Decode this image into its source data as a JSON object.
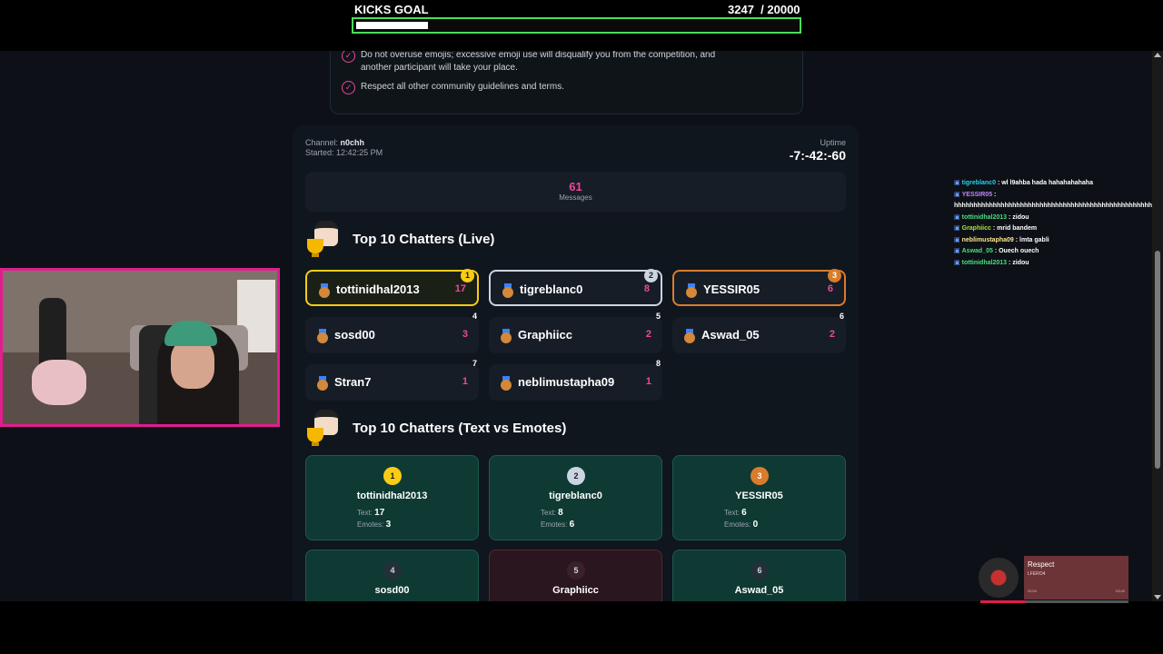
{
  "goal": {
    "title": "KICKS GOAL",
    "current": "3247",
    "target": "/ 20000",
    "progress": 0.162,
    "fill_color": "#ffffff",
    "border_color": "#4ade5a"
  },
  "rules": [
    "Do not overuse emojis; excessive emoji use will disqualify you from the competition, and another participant will take your place.",
    "Respect all other community guidelines and terms."
  ],
  "stream": {
    "channel_label": "Channel:",
    "channel": "n0chh",
    "started_label": "Started:",
    "started": "12:42:25 PM",
    "uptime_label": "Uptime",
    "uptime": "-7:-42:-60",
    "messages_count": "61",
    "messages_label": "Messages"
  },
  "live": {
    "title": "Top 10 Chatters (Live)",
    "chatters": [
      {
        "rank": "1",
        "name": "tottinidhal2013",
        "count": "17",
        "tier": "gold"
      },
      {
        "rank": "2",
        "name": "tigreblanc0",
        "count": "8",
        "tier": "silver"
      },
      {
        "rank": "3",
        "name": "YESSIR05",
        "count": "6",
        "tier": "bronze"
      },
      {
        "rank": "4",
        "name": "sosd00",
        "count": "3",
        "tier": ""
      },
      {
        "rank": "5",
        "name": "Graphiicc",
        "count": "2",
        "tier": ""
      },
      {
        "rank": "6",
        "name": "Aswad_05",
        "count": "2",
        "tier": ""
      },
      {
        "rank": "7",
        "name": "Stran7",
        "count": "1",
        "tier": ""
      },
      {
        "rank": "8",
        "name": "neblimustapha09",
        "count": "1",
        "tier": ""
      }
    ]
  },
  "split": {
    "title": "Top 10 Chatters (Text vs Emotes)",
    "text_label": "Text:",
    "emotes_label": "Emotes:",
    "cards": [
      {
        "rank": "1",
        "name": "tottinidhal2013",
        "text": "17",
        "emotes": "3",
        "tier": "gold"
      },
      {
        "rank": "2",
        "name": "tigreblanc0",
        "text": "8",
        "emotes": "6",
        "tier": "silver"
      },
      {
        "rank": "3",
        "name": "YESSIR05",
        "text": "6",
        "emotes": "0",
        "tier": "bronze"
      },
      {
        "rank": "4",
        "name": "sosd00",
        "tier": ""
      },
      {
        "rank": "5",
        "name": "Graphiicc",
        "tier": "pink"
      },
      {
        "rank": "6",
        "name": "Aswad_05",
        "tier": ""
      }
    ]
  },
  "chat": [
    {
      "user": "tigreblanc0",
      "color": "#22d3ee",
      "msg": ": wl l9ahba hada hahahahahaha"
    },
    {
      "user": "YESSIR05",
      "color": "#c084fc",
      "msg": ":"
    },
    {
      "user": "",
      "color": "#ffffff",
      "msg": "hhhhhhhhhhhhhhhhhhhhhhhhhhhhhhhhhhhhhhhhhhhhhhhhhhhhhhhhhhhhhhhhhh"
    },
    {
      "user": "tottinidhal2013",
      "color": "#4ade80",
      "msg": ": zidou"
    },
    {
      "user": "Graphiicc",
      "color": "#a3e635",
      "msg": ": mrid bandem"
    },
    {
      "user": "neblimustapha09",
      "color": "#fde68a",
      "msg": ": lmta gabli"
    },
    {
      "user": "Aswad_05",
      "color": "#4ade80",
      "msg": ": Ouech ouech"
    },
    {
      "user": "tottinidhal2013",
      "color": "#4ade80",
      "msg": ": zidou"
    }
  ],
  "now_playing": {
    "title": "Respect",
    "artist": "LFERO4",
    "elapsed": "00:54",
    "total": "03:40",
    "progress": 0.3
  }
}
